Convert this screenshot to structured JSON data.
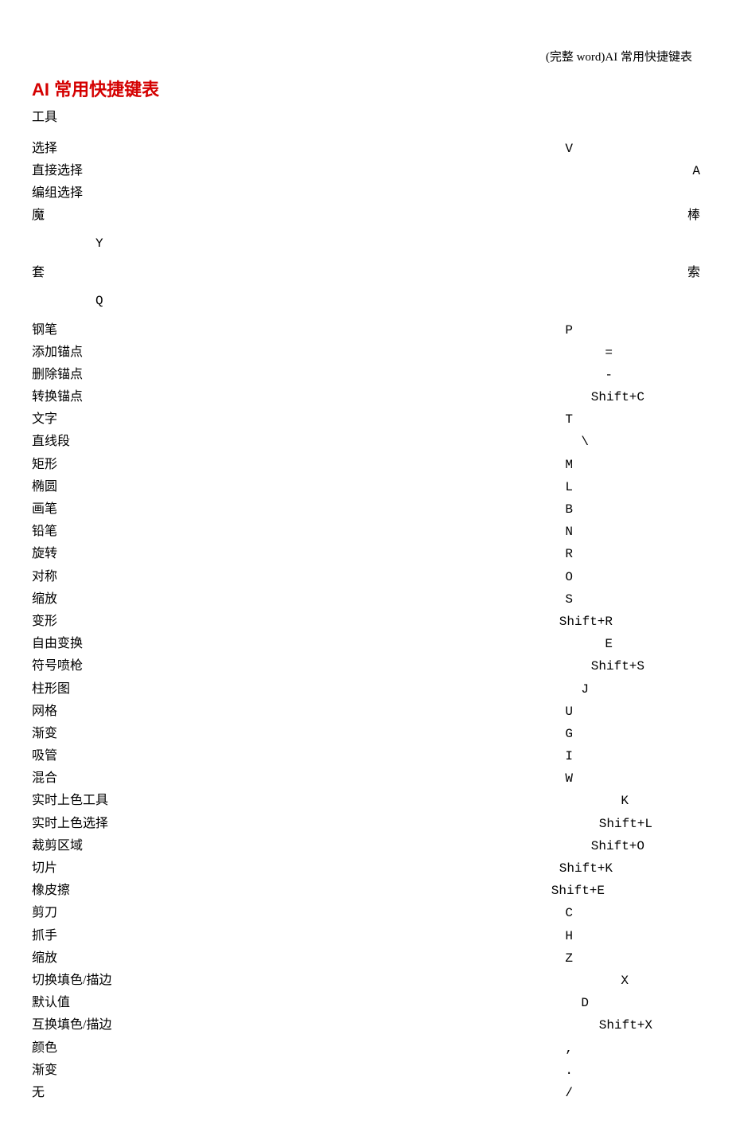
{
  "header_note": "(完整 word)AI 常用快捷键表",
  "title": "AI 常用快捷键表",
  "section": "工具",
  "rows": [
    {
      "label": "选择",
      "key": "V",
      "indent": "indent-1"
    },
    {
      "label": "直接选择",
      "key": "A",
      "indent": "indent-6"
    },
    {
      "label": "编组选择",
      "key": "",
      "indent": ""
    },
    {
      "split": true,
      "left": "魔",
      "right": "棒",
      "key": "Y"
    },
    {
      "split": true,
      "left": "套",
      "right": "索",
      "key": "Q"
    },
    {
      "label": "钢笔",
      "key": "P",
      "indent": "indent-1"
    },
    {
      "label": "添加锚点",
      "key": "=",
      "indent": "indent-2"
    },
    {
      "label": "删除锚点",
      "key": "-",
      "indent": "indent-2"
    },
    {
      "label": "转换锚点",
      "key": "Shift+C",
      "indent": "indent-9"
    },
    {
      "label": "文字",
      "key": "T",
      "indent": "indent-1"
    },
    {
      "label": "直线段",
      "key": "\\",
      "indent": "indent-7"
    },
    {
      "label": "矩形",
      "key": "M",
      "indent": "indent-1"
    },
    {
      "label": "椭圆",
      "key": "L",
      "indent": "indent-1"
    },
    {
      "label": "画笔",
      "key": "B",
      "indent": "indent-1"
    },
    {
      "label": "铅笔",
      "key": "N",
      "indent": "indent-1"
    },
    {
      "label": "旋转",
      "key": "R",
      "indent": "indent-1"
    },
    {
      "label": "对称",
      "key": "O",
      "indent": "indent-1"
    },
    {
      "label": "缩放",
      "key": "S",
      "indent": "indent-1"
    },
    {
      "label": "变形",
      "key": "Shift+R",
      "indent": "indent-2"
    },
    {
      "label": "自由变换",
      "key": "E",
      "indent": "indent-2"
    },
    {
      "label": "符号喷枪",
      "key": "Shift+S",
      "indent": "indent-9"
    },
    {
      "label": "柱形图",
      "key": "J",
      "indent": "indent-7"
    },
    {
      "label": "网格",
      "key": "U",
      "indent": "indent-1"
    },
    {
      "label": "渐变",
      "key": "G",
      "indent": "indent-1"
    },
    {
      "label": "吸管",
      "key": "I",
      "indent": "indent-1"
    },
    {
      "label": "混合",
      "key": "W",
      "indent": "indent-1"
    },
    {
      "label": "实时上色工具",
      "key": "K",
      "indent": "indent-3"
    },
    {
      "label": "实时上色选择",
      "key": "Shift+L",
      "indent": "indent-4"
    },
    {
      "label": "裁剪区域",
      "key": "Shift+O",
      "indent": "indent-9"
    },
    {
      "label": "切片",
      "key": "Shift+K",
      "indent": "indent-2"
    },
    {
      "label": "橡皮擦",
      "key": "Shift+E",
      "indent": "indent-8"
    },
    {
      "label": "剪刀",
      "key": "C",
      "indent": "indent-1"
    },
    {
      "label": "抓手",
      "key": "H",
      "indent": "indent-1"
    },
    {
      "label": "缩放",
      "key": "Z",
      "indent": "indent-1"
    },
    {
      "label": "切换填色/描边",
      "key": "X",
      "indent": "indent-3"
    },
    {
      "label": "默认值",
      "key": "D",
      "indent": "indent-7"
    },
    {
      "label": "互换填色/描边",
      "key": "Shift+X",
      "indent": "indent-4"
    },
    {
      "label": "颜色",
      "key": ",",
      "indent": "indent-1"
    },
    {
      "label": "渐变",
      "key": ".",
      "indent": "indent-1"
    },
    {
      "label": "无",
      "key": "/",
      "indent": "indent-1"
    }
  ]
}
